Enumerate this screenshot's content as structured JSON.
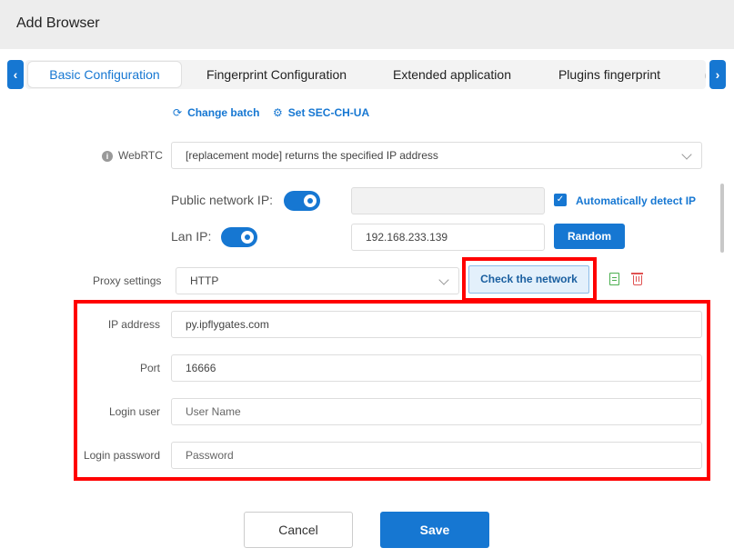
{
  "window": {
    "title": "Add Browser"
  },
  "tabs": {
    "prev_icon": "chevron-left-icon",
    "next_icon": "chevron-right-icon",
    "items": [
      {
        "label": "Basic Configuration",
        "active": true
      },
      {
        "label": "Fingerprint Configuration",
        "active": false
      },
      {
        "label": "Extended application",
        "active": false
      },
      {
        "label": "Plugins fingerprint",
        "active": false
      }
    ]
  },
  "links": {
    "change_batch": "Change batch",
    "set_sec_ch_ua": "Set SEC-CH-UA"
  },
  "webrtc": {
    "label": "WebRTC",
    "value": "[replacement mode] returns the specified IP address",
    "public_ip_label": "Public network IP:",
    "public_ip_enabled": true,
    "public_ip_value": "",
    "auto_detect_label": "Automatically detect IP",
    "auto_detect_checked": true,
    "lan_ip_label": "Lan IP:",
    "lan_ip_enabled": true,
    "lan_ip_value": "192.168.233.139",
    "random_label": "Random"
  },
  "proxy": {
    "label": "Proxy settings",
    "type": "HTTP",
    "check_network_label": "Check the network",
    "ip_label": "IP address",
    "ip_value": "py.ipflygates.com",
    "port_label": "Port",
    "port_value": "16666",
    "user_label": "Login user",
    "user_placeholder": "User Name",
    "password_label": "Login password",
    "password_placeholder": "Password"
  },
  "footer": {
    "cancel_label": "Cancel",
    "save_label": "Save"
  },
  "colors": {
    "accent": "#1677d2",
    "highlight": "#ff0000"
  }
}
